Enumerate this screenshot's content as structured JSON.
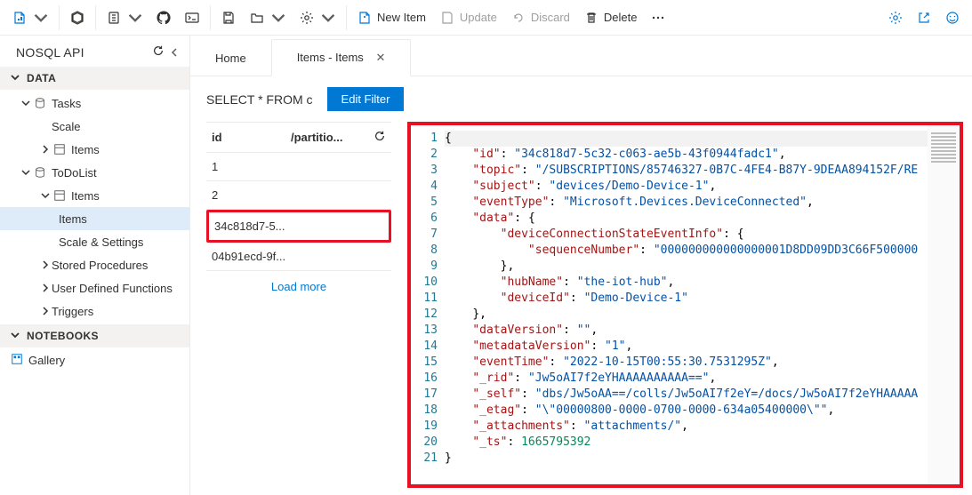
{
  "toolbar": {
    "new_item_label": "New Item",
    "update_label": "Update",
    "discard_label": "Discard",
    "delete_label": "Delete"
  },
  "sidebar": {
    "header": "NOSQL API",
    "section_data": "DATA",
    "section_notebooks": "NOTEBOOKS",
    "gallery_label": "Gallery",
    "tree": {
      "tasks": "Tasks",
      "tasks_scale": "Scale",
      "tasks_items": "Items",
      "todolist": "ToDoList",
      "todolist_items": "Items",
      "todolist_items_items": "Items",
      "todolist_scale_settings": "Scale & Settings",
      "sp": "Stored Procedures",
      "udf": "User Defined Functions",
      "triggers": "Triggers"
    }
  },
  "tabs": {
    "home": "Home",
    "items": "Items - Items"
  },
  "query": {
    "text": "SELECT * FROM c",
    "edit_filter": "Edit Filter"
  },
  "item_list": {
    "col_id": "id",
    "col_pk": "/partitio...",
    "rows": [
      "1",
      "2",
      "34c818d7-5...",
      "04b91ecd-9f..."
    ],
    "load_more": "Load more"
  },
  "json_doc": {
    "id": "34c818d7-5c32-c063-ae5b-43f0944fadc1",
    "topic": "/SUBSCRIPTIONS/85746327-0B7C-4FE4-B87Y-9DEAA894152F/RE",
    "subject": "devices/Demo-Device-1",
    "eventType": "Microsoft.Devices.DeviceConnected",
    "sequenceNumber": "000000000000000001D8DD09DD3C66F500000",
    "hubName": "the-iot-hub",
    "deviceId": "Demo-Device-1",
    "dataVersion": "",
    "metadataVersion": "1",
    "eventTime": "2022-10-15T00:55:30.7531295Z",
    "_rid": "Jw5oAI7f2eYHAAAAAAAAAA==",
    "_self": "dbs/Jw5oAA==/colls/Jw5oAI7f2eY=/docs/Jw5oAI7f2eYHAAAAA",
    "_etag": "\\\"00000800-0000-0700-0000-634a05400000\\\"",
    "_attachments": "attachments/",
    "_ts": 1665795392
  }
}
